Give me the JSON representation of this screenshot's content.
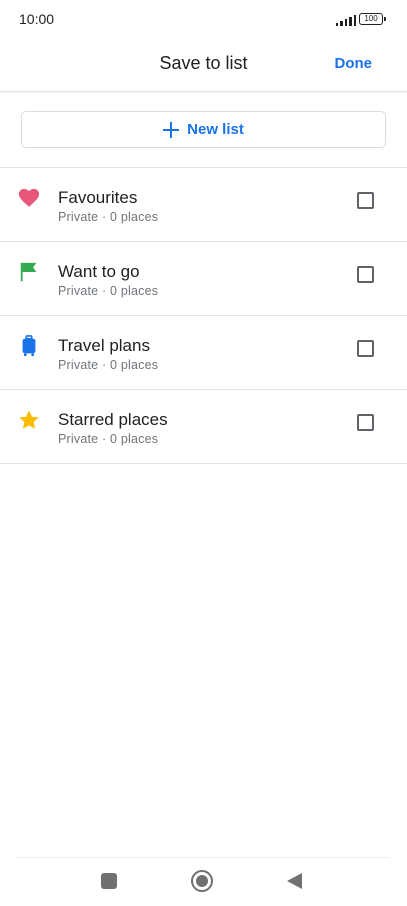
{
  "status_bar": {
    "time": "10:00",
    "battery": "100"
  },
  "header": {
    "title": "Save to list",
    "done_label": "Done"
  },
  "new_list": {
    "label": "New list"
  },
  "lists": [
    {
      "name": "Favourites",
      "subtitle": "Private · 0 places",
      "icon": "heart-icon",
      "color": "#e8577a",
      "checked": false
    },
    {
      "name": "Want to go",
      "subtitle": "Private · 0 places",
      "icon": "flag-icon",
      "color": "#34a853",
      "checked": false
    },
    {
      "name": "Travel plans",
      "subtitle": "Private · 0 places",
      "icon": "suitcase-icon",
      "color": "#1a73e8",
      "checked": false
    },
    {
      "name": "Starred places",
      "subtitle": "Private · 0 places",
      "icon": "star-icon",
      "color": "#fbbc04",
      "checked": false
    }
  ],
  "colors": {
    "accent": "#1a73e8",
    "text": "#202124",
    "secondary_text": "#70757a"
  }
}
